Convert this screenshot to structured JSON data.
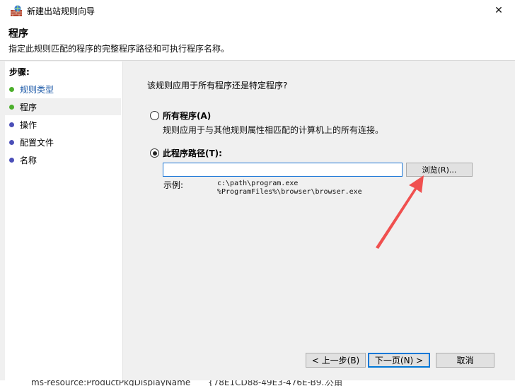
{
  "window": {
    "title": "新建出站规则向导",
    "close_glyph": "✕"
  },
  "header": {
    "title": "程序",
    "description": "指定此规则匹配的程序的完整程序路径和可执行程序名称。"
  },
  "sidebar": {
    "steps_label": "步骤:",
    "items": [
      {
        "label": "规则类型",
        "dot_color": "#4caf2c"
      },
      {
        "label": "程序",
        "dot_color": "#4caf2c"
      },
      {
        "label": "操作",
        "dot_color": "#4b4fb8"
      },
      {
        "label": "配置文件",
        "dot_color": "#4b4fb8"
      },
      {
        "label": "名称",
        "dot_color": "#4b4fb8"
      }
    ]
  },
  "main": {
    "question": "该规则应用于所有程序还是特定程序?",
    "all_programs": {
      "label": "所有程序(A)",
      "description": "规则应用于与其他规则属性相匹配的计算机上的所有连接。"
    },
    "program_path": {
      "label": "此程序路径(T):",
      "value": "",
      "browse_label": "浏览(R)..."
    },
    "example": {
      "label": "示例:",
      "line1": "c:\\path\\program.exe",
      "line2": "%ProgramFiles%\\browser\\browser.exe"
    }
  },
  "buttons": {
    "back": "< 上一步(B)",
    "next": "下一页(N) >",
    "cancel": "取消"
  },
  "background_row": {
    "text1": "ms-resource:ProductPkgDisplayName",
    "text2": "{78E1CD88-49E3-476E-B9...",
    "text3": "公用"
  },
  "colors": {
    "accent": "#0078d7",
    "arrow": "#f0504f",
    "link": "#1d5aa8"
  },
  "icons": {
    "title": "firewall-wall-icon",
    "close": "close-icon"
  }
}
